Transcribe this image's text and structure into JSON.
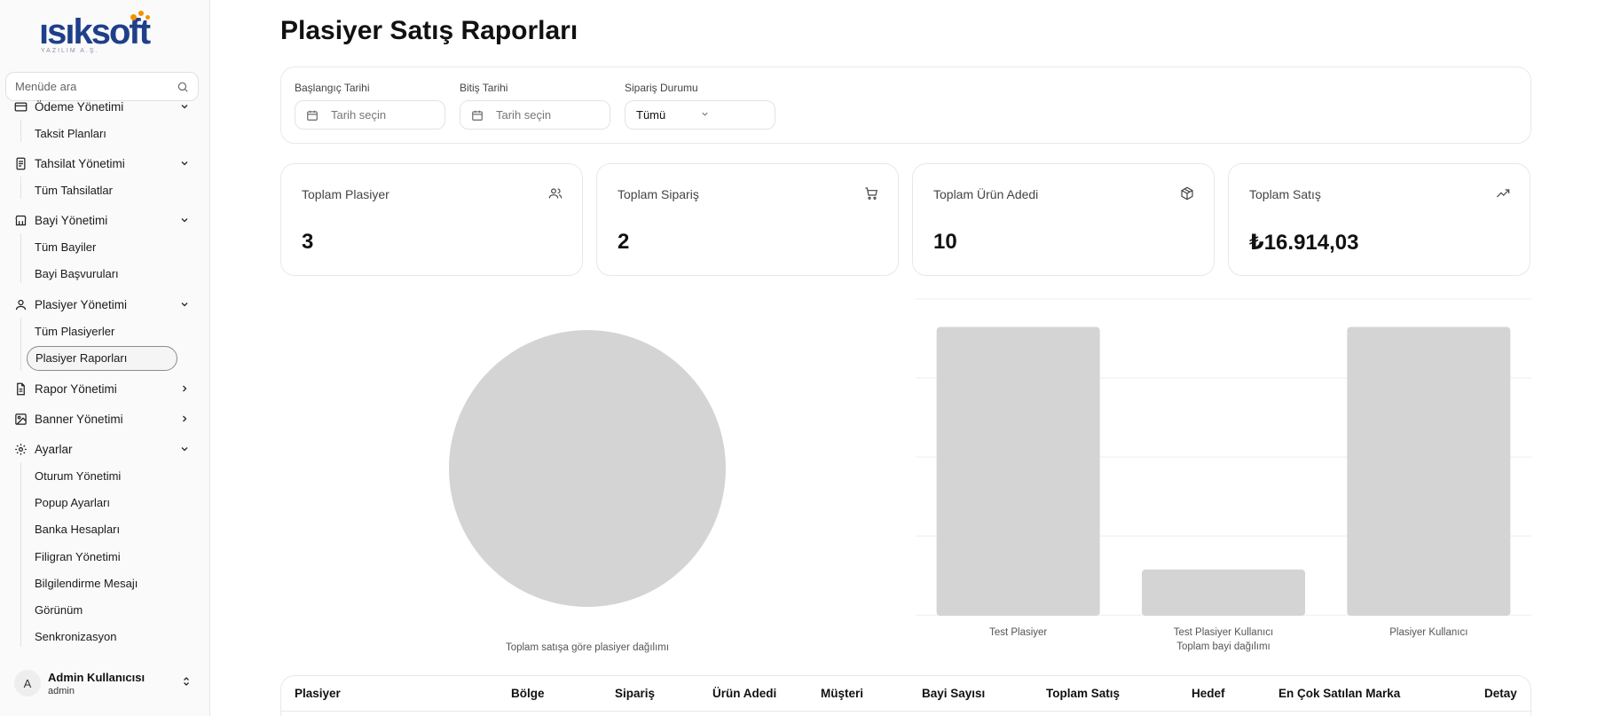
{
  "brand": {
    "logo_text": "ısıksoft",
    "logo_sub": "YAZILIM A.Ş."
  },
  "search": {
    "placeholder": "Menüde ara"
  },
  "sidebar": {
    "groups": [
      {
        "label": "Ödeme Yönetimi",
        "icon": "credit-card-icon",
        "expanded": true,
        "items": [
          "Taksit Planları"
        ]
      },
      {
        "label": "Tahsilat Yönetimi",
        "icon": "receipt-icon",
        "expanded": true,
        "items": [
          "Tüm Tahsilatlar"
        ]
      },
      {
        "label": "Bayi Yönetimi",
        "icon": "store-icon",
        "expanded": true,
        "items": [
          "Tüm Bayiler",
          "Bayi Başvuruları"
        ]
      },
      {
        "label": "Plasiyer Yönetimi",
        "icon": "user-icon",
        "expanded": true,
        "items": [
          "Tüm Plasiyerler",
          "Plasiyer Raporları"
        ]
      },
      {
        "label": "Rapor Yönetimi",
        "icon": "file-icon",
        "expanded": false,
        "items": []
      },
      {
        "label": "Banner Yönetimi",
        "icon": "image-icon",
        "expanded": false,
        "items": []
      },
      {
        "label": "Ayarlar",
        "icon": "gear-icon",
        "expanded": true,
        "items": [
          "Oturum Yönetimi",
          "Popup Ayarları",
          "Banka Hesapları",
          "Filigran Yönetimi",
          "Bilgilendirme Mesajı",
          "Görünüm",
          "Senkronizasyon"
        ]
      }
    ],
    "active_item": "Plasiyer Raporları"
  },
  "user": {
    "initial": "A",
    "name": "Admin Kullanıcısı",
    "role": "admin"
  },
  "page": {
    "title": "Plasiyer Satış Raporları"
  },
  "filters": {
    "start_label": "Başlangıç Tarihi",
    "start_placeholder": "Tarih seçin",
    "end_label": "Bitiş Tarihi",
    "end_placeholder": "Tarih seçin",
    "status_label": "Sipariş Durumu",
    "status_value": "Tümü"
  },
  "stats": [
    {
      "label": "Toplam Plasiyer",
      "value": "3",
      "icon": "users-icon"
    },
    {
      "label": "Toplam Sipariş",
      "value": "2",
      "icon": "cart-icon"
    },
    {
      "label": "Toplam Ürün Adedi",
      "value": "10",
      "icon": "package-icon"
    },
    {
      "label": "Toplam Satış",
      "value": "₺16.914,03",
      "icon": "trending-up-icon"
    }
  ],
  "pie_caption": "Toplam satışa göre plasiyer dağılımı",
  "chart_data": [
    {
      "type": "pie",
      "title": "",
      "categories": [
        ""
      ],
      "values": [
        1
      ],
      "caption": "Toplam satışa göre plasiyer dağılımı",
      "color": "#d4d4d4"
    },
    {
      "type": "bar",
      "title": "",
      "categories": [
        "Test Plasiyer",
        "Test Plasiyer Kullanıcı",
        "Plasiyer Kullanıcı"
      ],
      "values": [
        1,
        0.16,
        1
      ],
      "ylim": [
        0,
        1.1
      ],
      "grid": true,
      "xlabel": "Toplam bayi dağılımı",
      "ylabel": "",
      "color": "#d4d4d4"
    }
  ],
  "table": {
    "columns": [
      "Plasiyer",
      "Bölge",
      "Sipariş",
      "Ürün Adedi",
      "Müşteri",
      "Bayi Sayısı",
      "Toplam Satış",
      "Hedef",
      "En Çok Satılan Marka",
      "Detay"
    ]
  },
  "colors": {
    "brand_blue": "#1f3f8a",
    "brand_orange": "#f39200",
    "chart_gray": "#d4d4d4"
  }
}
